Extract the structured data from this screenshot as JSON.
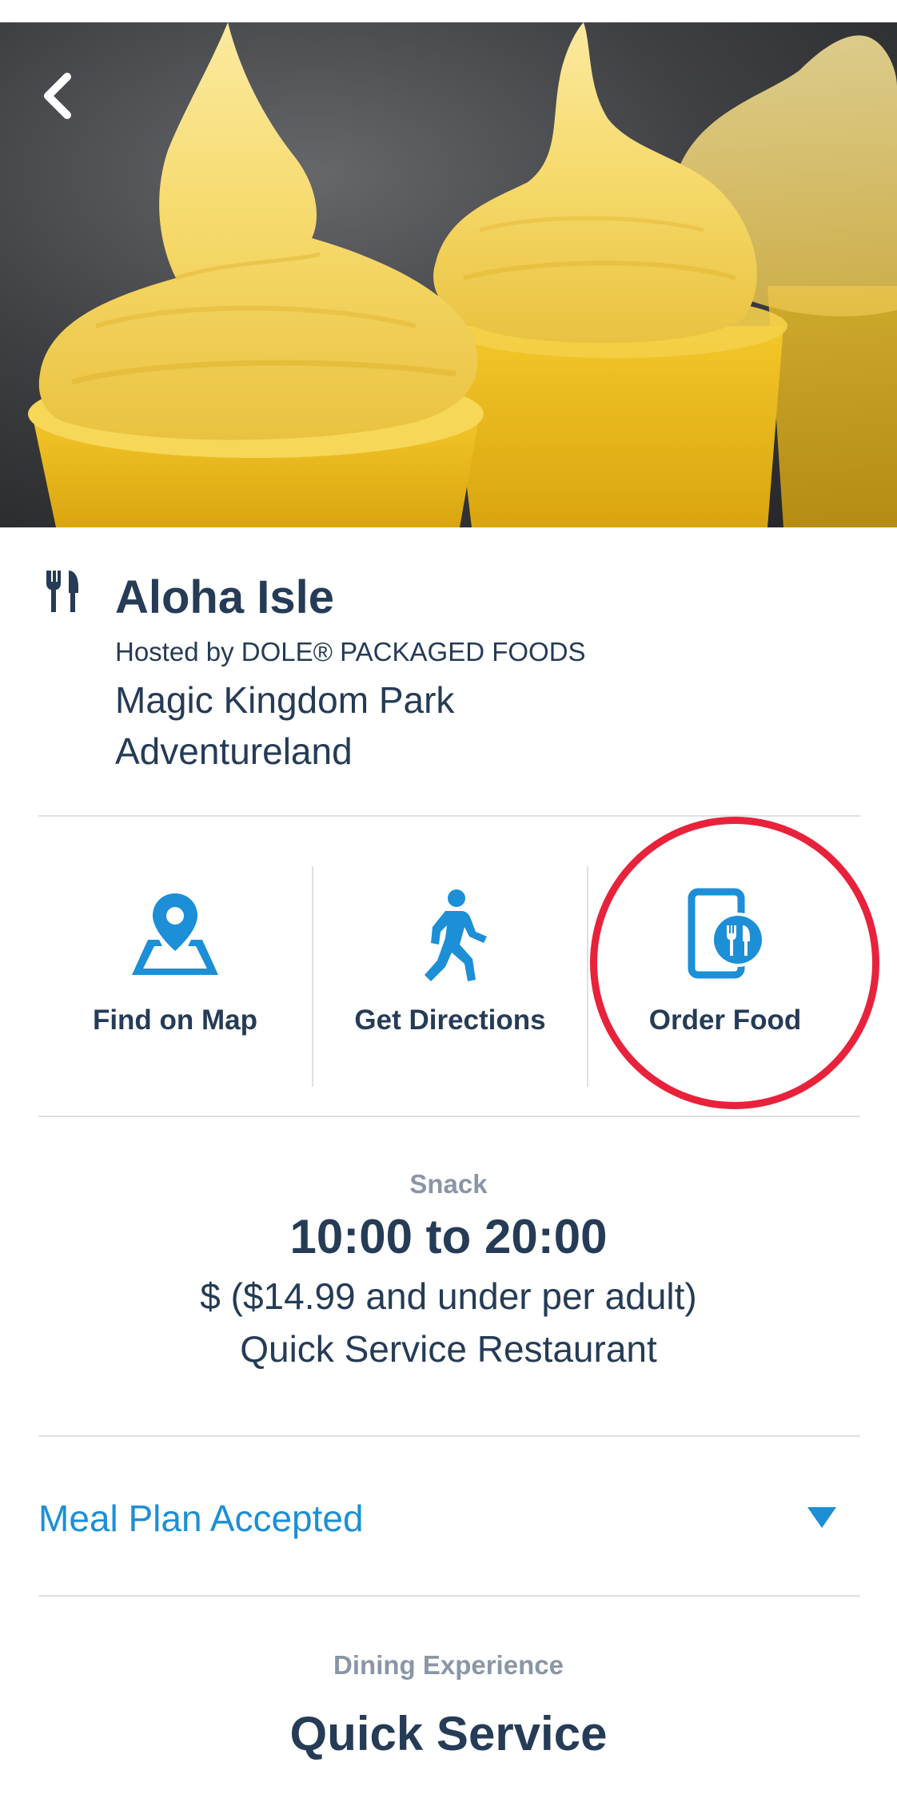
{
  "restaurant": {
    "name": "Aloha Isle",
    "host": "Hosted by DOLE® PACKAGED FOODS",
    "park": "Magic Kingdom Park",
    "land": "Adventureland"
  },
  "actions": [
    {
      "label": "Find on Map",
      "icon": "map-pin-icon"
    },
    {
      "label": "Get Directions",
      "icon": "walking-person-icon"
    },
    {
      "label": "Order Food",
      "icon": "mobile-order-icon"
    }
  ],
  "hours": {
    "meal_period": "Snack",
    "time_range": "10:00 to 20:00",
    "price_range": "$ ($14.99 and under per adult)",
    "service_type": "Quick Service Restaurant"
  },
  "meal_plan": {
    "label": "Meal Plan Accepted",
    "icon": "caret-down-icon"
  },
  "dining_experience": {
    "label": "Dining Experience",
    "value": "Quick Service"
  },
  "colors": {
    "text_primary": "#253b56",
    "accent_blue": "#1c8fd6",
    "muted_text": "#8a96a6",
    "divider": "#dde0e4",
    "highlight_red": "#e8223b"
  }
}
